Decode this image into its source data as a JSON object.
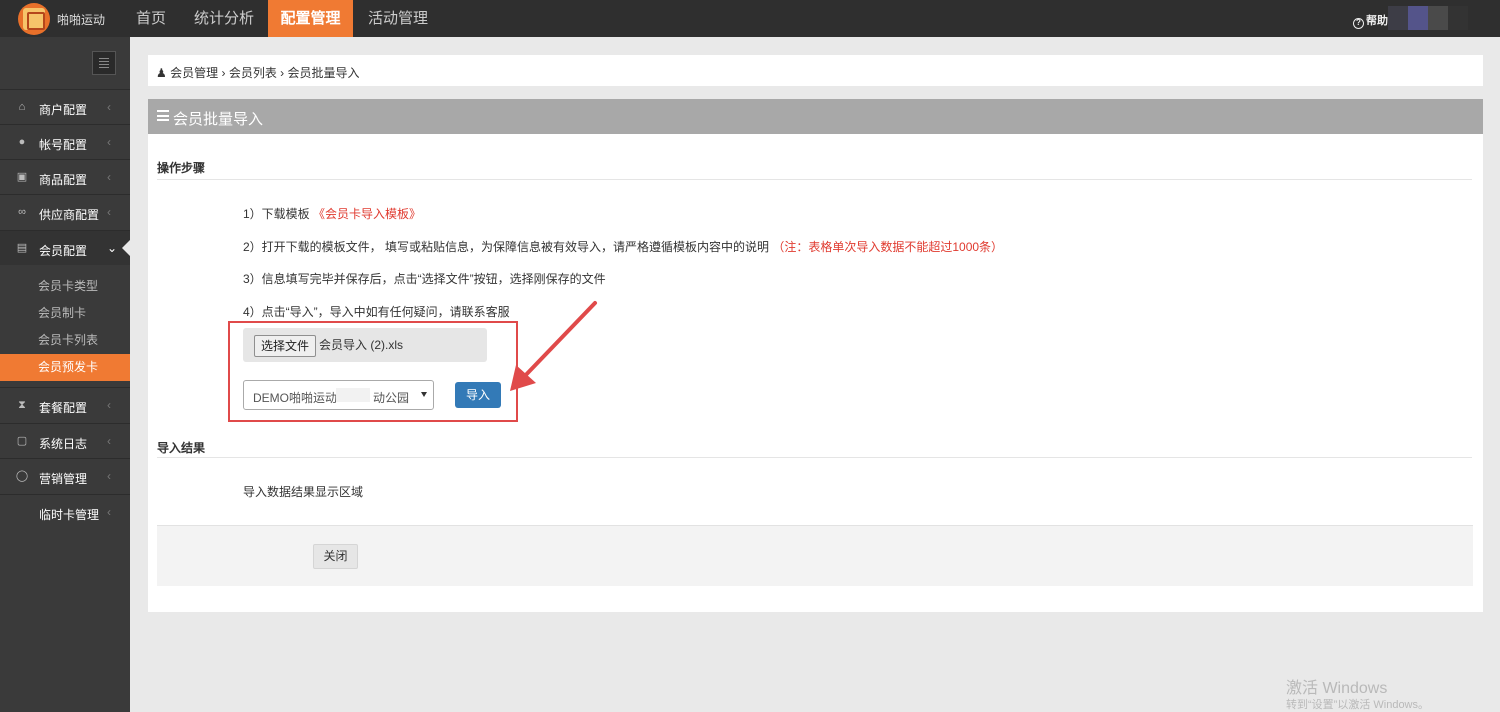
{
  "header": {
    "brand": "啪啪运动",
    "tabs": [
      {
        "label": "首页"
      },
      {
        "label": "统计分析"
      },
      {
        "label": "配置管理"
      },
      {
        "label": "活动管理"
      }
    ],
    "help_label": "帮助",
    "help_icon": "question-circle-icon"
  },
  "sidebar": {
    "items": [
      {
        "label": "商户配置",
        "icon": "home-icon"
      },
      {
        "label": "帐号配置",
        "icon": "user-icon"
      },
      {
        "label": "商品配置",
        "icon": "gift-icon"
      },
      {
        "label": "供应商配置",
        "icon": "link-icon"
      },
      {
        "label": "会员配置",
        "icon": "id-card-icon"
      },
      {
        "label": "套餐配置",
        "icon": "hourglass-icon"
      },
      {
        "label": "系统日志",
        "icon": "note-icon"
      },
      {
        "label": "营销管理",
        "icon": "chat-icon"
      },
      {
        "label": "临时卡管理",
        "icon": ""
      }
    ],
    "sub_items": [
      {
        "label": "会员卡类型"
      },
      {
        "label": "会员制卡"
      },
      {
        "label": "会员卡列表"
      },
      {
        "label": "会员预发卡"
      }
    ]
  },
  "breadcrumb": {
    "items": [
      "会员管理",
      "会员列表",
      "会员批量导入"
    ],
    "separator": "›"
  },
  "panel": {
    "title": "会员批量导入",
    "steps_title": "操作步骤",
    "step1": "1）下载模板",
    "step1_link": "《会员卡导入模板》",
    "step2": "2）打开下载的模板文件， 填写或粘贴信息，为保障信息被有效导入，请严格遵循模板内容中的说明",
    "step2_note": "（注：表格单次导入数据不能超过1000条）",
    "step3": "3）信息填写完毕并保存后，点击“选择文件”按钮，选择刚保存的文件",
    "step4": "4）点击“导入”，导入中如有任何疑问，请联系客服",
    "file_button": "选择文件",
    "file_name": "会员导入 (2).xls",
    "venue_select": "DEMO啪啪运动",
    "venue_select_tail": "动公园",
    "import_button": "导入",
    "result_title": "导入结果",
    "result_text": "导入数据结果显示区域",
    "close_button": "关闭"
  },
  "watermark": {
    "line1": "激活 Windows",
    "line2": "转到“设置”以激活 Windows。"
  },
  "colors": {
    "topbar": "#2f2f2f",
    "accent": "#f07a33",
    "sidebar": "#3a3a3a",
    "primary_button": "#337ab7",
    "danger_text": "#e03a2f",
    "annotation": "#e04a4a"
  }
}
